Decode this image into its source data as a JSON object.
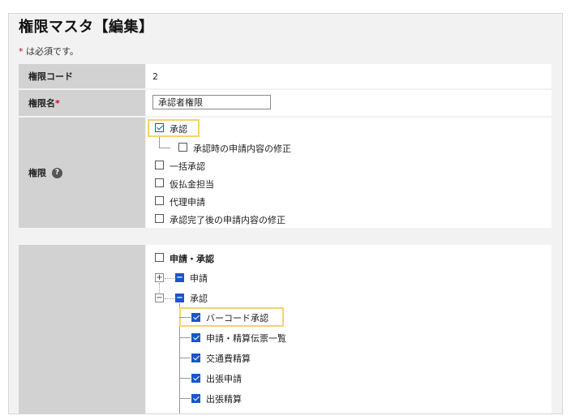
{
  "page": {
    "title": "権限マスタ【編集】",
    "required_star": "*",
    "required_note": "は必須です。"
  },
  "form": {
    "code": {
      "label": "権限コード",
      "value": "2"
    },
    "name": {
      "label": "権限名",
      "required_star": "*",
      "value": "承認者権限"
    },
    "permission": {
      "label": "権限",
      "help_icon": "?",
      "items": [
        {
          "label": "承認",
          "checked": true
        },
        {
          "label": "承認時の申請内容の修正",
          "checked": false
        },
        {
          "label": "一括承認",
          "checked": false
        },
        {
          "label": "仮払金担当",
          "checked": false
        },
        {
          "label": "代理申請",
          "checked": false
        },
        {
          "label": "承認完了後の申請内容の修正",
          "checked": false
        }
      ]
    },
    "menu_tree": {
      "root": {
        "label": "申請・承認",
        "checked": false
      },
      "nodes": [
        {
          "label": "申請",
          "expander": "+",
          "toggle": "−"
        },
        {
          "label": "承認",
          "expander": "−",
          "toggle": "−"
        }
      ],
      "children": [
        {
          "label": "バーコード承認",
          "checked": true
        },
        {
          "label": "申請・精算伝票一覧",
          "checked": true
        },
        {
          "label": "交通費精算",
          "checked": true
        },
        {
          "label": "出張申請",
          "checked": true
        },
        {
          "label": "出張精算",
          "checked": true
        }
      ]
    }
  },
  "colors": {
    "accent": "#1a56c8",
    "highlight": "#f5d46a",
    "required": "#d0021b",
    "label_bg": "#d2d2d2"
  }
}
